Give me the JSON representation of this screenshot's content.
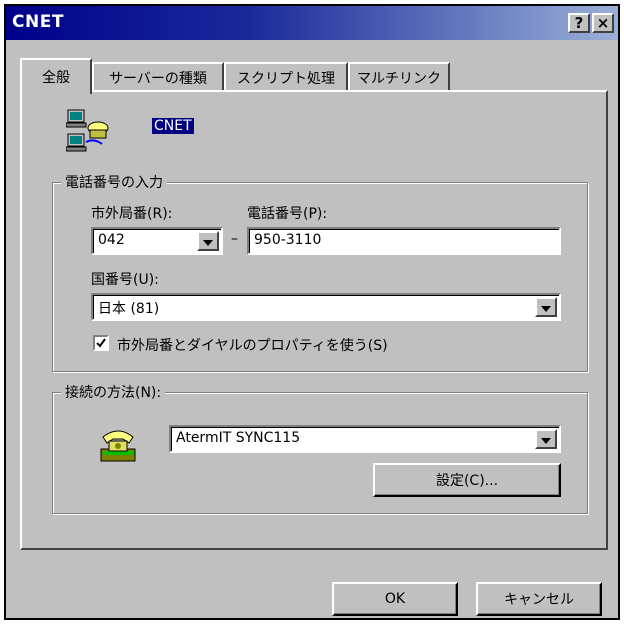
{
  "window": {
    "title": "CNET",
    "help_label": "?",
    "close_label": "×"
  },
  "tabs": [
    {
      "label": "全般",
      "active": true
    },
    {
      "label": "サーバーの種類",
      "active": false
    },
    {
      "label": "スクリプト処理",
      "active": false
    },
    {
      "label": "マルチリンク",
      "active": false
    }
  ],
  "connection": {
    "name": "CNET",
    "icon": "dialup-connection-icon"
  },
  "phone_group": {
    "legend": "電話番号の入力",
    "area_code_label": "市外局番(R):",
    "area_code_value": "042",
    "dash": "–",
    "phone_label": "電話番号(P):",
    "phone_value": "950-3110",
    "country_label": "国番号(U):",
    "country_value": "日本 (81)",
    "use_dialing_props_label": "市外局番とダイヤルのプロパティを使う(S)",
    "use_dialing_props_checked": true
  },
  "connect_group": {
    "legend": "接続の方法(N):",
    "modem_icon": "telephone-icon",
    "device_value": "AtermIT SYNC115",
    "configure_label": "設定(C)..."
  },
  "footer": {
    "ok_label": "OK",
    "cancel_label": "キャンセル"
  }
}
